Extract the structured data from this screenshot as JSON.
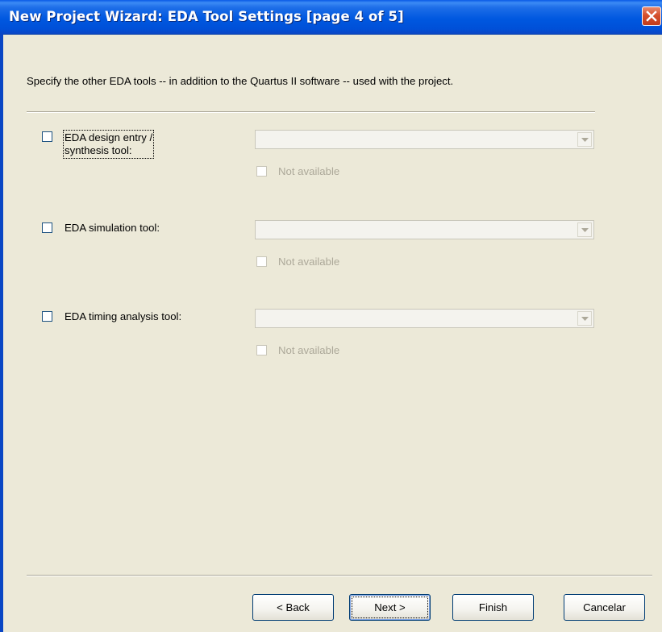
{
  "window": {
    "title": "New Project Wizard: EDA Tool Settings [page 4 of 5]"
  },
  "description": "Specify the other EDA tools -- in addition to the Quartus II software -- used with the project.",
  "tools": [
    {
      "label_line1": "EDA design entry /",
      "label_line2": "synthesis tool:",
      "checked": false,
      "selected_value": "",
      "not_available_label": "Not available"
    },
    {
      "label": "EDA simulation tool:",
      "checked": false,
      "selected_value": "",
      "not_available_label": "Not available"
    },
    {
      "label": "EDA timing analysis tool:",
      "checked": false,
      "selected_value": "",
      "not_available_label": "Not available"
    }
  ],
  "buttons": {
    "back": "< Back",
    "next": "Next >",
    "finish": "Finish",
    "cancel": "Cancelar"
  }
}
